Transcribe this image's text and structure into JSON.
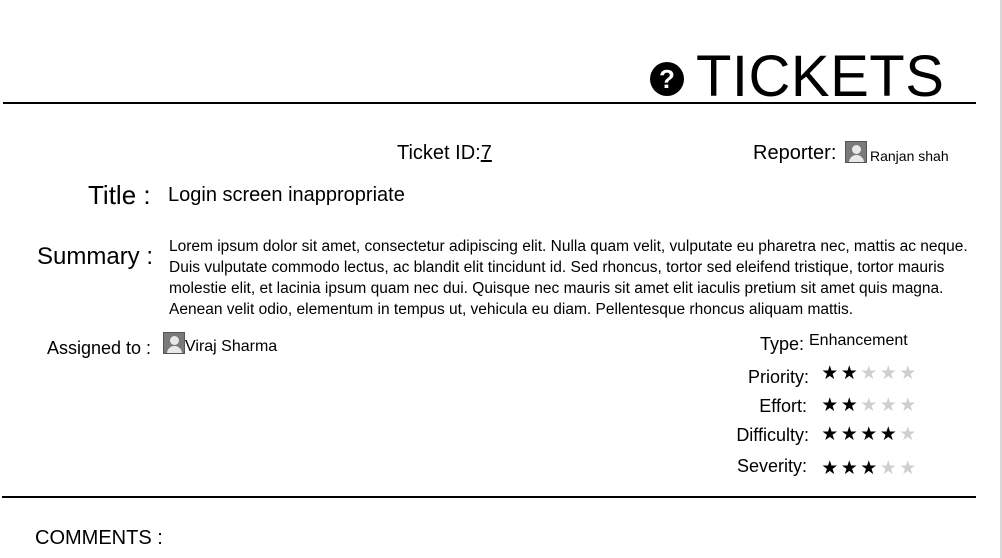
{
  "header": {
    "title": "TICKETS",
    "help_icon": "question-circle-icon"
  },
  "ticket": {
    "id_label": "Ticket ID:",
    "id_value": "7",
    "reporter_label": "Reporter:",
    "reporter_name": "Ranjan shah",
    "title_label": "Title :",
    "title_value": "Login screen inappropriate",
    "summary_label": "Summary :",
    "summary_text": "Lorem ipsum dolor sit amet, consectetur adipiscing elit. Nulla quam velit, vulputate eu pharetra nec, mattis ac neque. Duis vulputate commodo lectus, ac blandit elit tincidunt id. Sed rhoncus, tortor sed eleifend tristique, tortor mauris molestie elit, et lacinia ipsum quam nec dui. Quisque nec mauris sit amet elit iaculis pretium sit amet quis magna. Aenean velit odio, elementum in tempus ut, vehicula eu diam. Pellentesque rhoncus aliquam mattis.",
    "assigned_label": "Assigned to :",
    "assignee_name": "Viraj Sharma"
  },
  "properties": {
    "type_label": "Type:",
    "type_value": "Enhancement",
    "priority_label": "Priority:",
    "priority_rating": 2,
    "effort_label": "Effort:",
    "effort_rating": 2,
    "difficulty_label": "Difficulty:",
    "difficulty_rating": 4,
    "severity_label": "Severity:",
    "severity_rating": 3,
    "rating_max": 5
  },
  "comments": {
    "label": "COMMENTS :"
  },
  "colors": {
    "star_on": "#000000",
    "star_off": "#cfcfcf",
    "rule": "#000000"
  }
}
